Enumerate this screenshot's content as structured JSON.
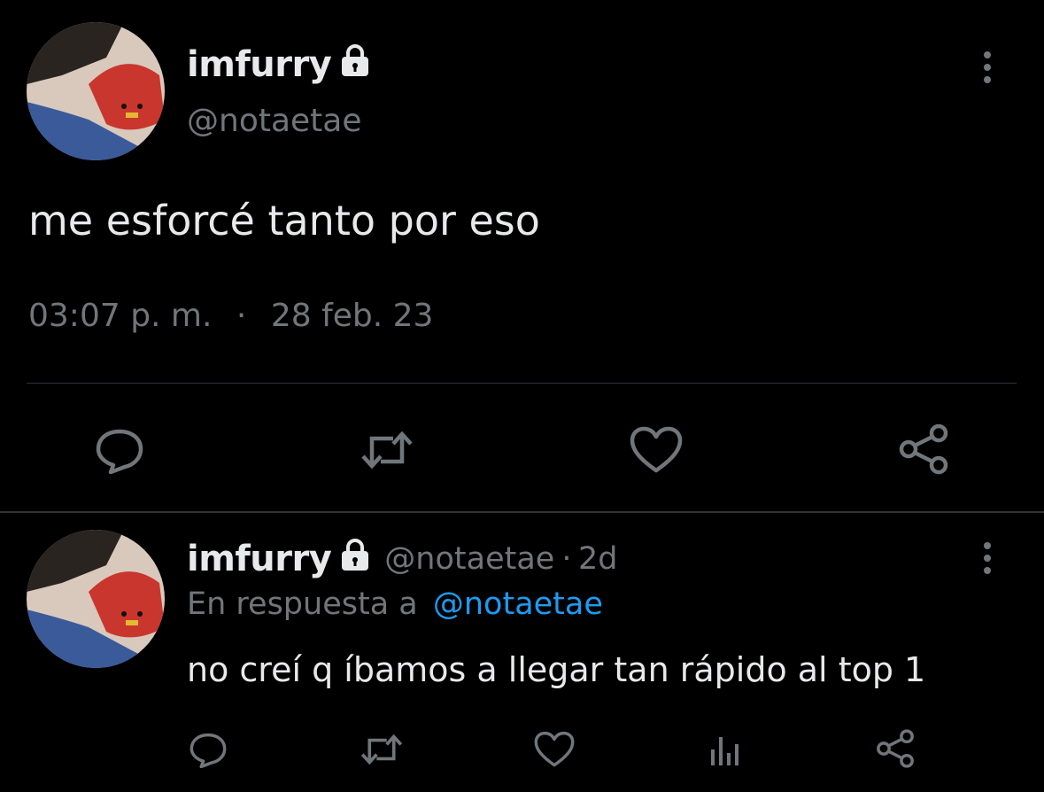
{
  "main_tweet": {
    "display_name": "imfurry",
    "handle": "@notaetae",
    "text": "me esforcé tanto por eso",
    "time": "03:07 p. m.",
    "separator": "·",
    "date": "28 feb. 23"
  },
  "reply_tweet": {
    "display_name": "imfurry",
    "handle": "@notaetae",
    "separator": "·",
    "age": "2d",
    "reply_prefix": "En respuesta a",
    "reply_to": "@notaetae",
    "text": "no creí q íbamos a llegar tan rápido al top 1"
  },
  "icons": {
    "lock": "lock-icon",
    "reply": "reply-icon",
    "retweet": "retweet-icon",
    "like": "heart-icon",
    "share": "share-icon",
    "analytics": "analytics-icon",
    "more": "more-vertical-icon"
  },
  "colors": {
    "background": "#000000",
    "text": "#e7e9ea",
    "muted": "#71767b",
    "link": "#1d9bf0",
    "divider": "#2f3336"
  }
}
